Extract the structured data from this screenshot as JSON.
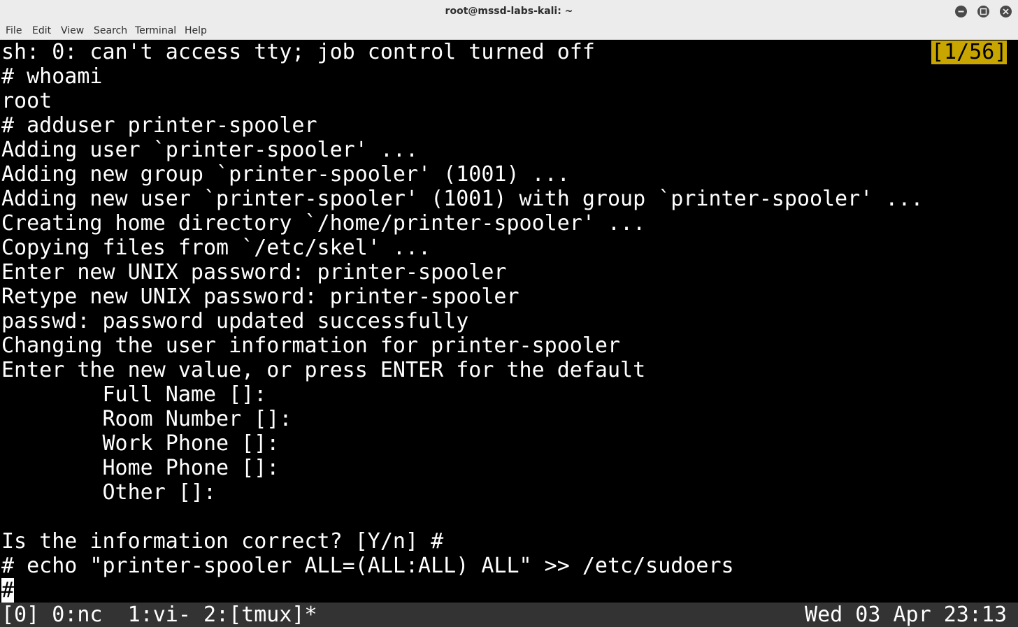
{
  "window": {
    "title": "root@mssd-labs-kali: ~",
    "controls": {
      "minimize_icon": "minimize-icon",
      "maximize_icon": "maximize-icon",
      "close_icon": "close-icon"
    }
  },
  "menu": {
    "items": [
      "File",
      "Edit",
      "View",
      "Search",
      "Terminal",
      "Help"
    ]
  },
  "terminal": {
    "pane_indicator": "[1/56]",
    "lines": [
      "sh: 0: can't access tty; job control turned off",
      "# whoami",
      "root",
      "# adduser printer-spooler",
      "Adding user `printer-spooler' ...",
      "Adding new group `printer-spooler' (1001) ...",
      "Adding new user `printer-spooler' (1001) with group `printer-spooler' ...",
      "Creating home directory `/home/printer-spooler' ...",
      "Copying files from `/etc/skel' ...",
      "Enter new UNIX password: printer-spooler",
      "Retype new UNIX password: printer-spooler",
      "passwd: password updated successfully",
      "Changing the user information for printer-spooler",
      "Enter the new value, or press ENTER for the default",
      "        Full Name []:",
      "        Room Number []:",
      "        Work Phone []:",
      "        Home Phone []:",
      "        Other []:",
      "",
      "Is the information correct? [Y/n] #",
      "# echo \"printer-spooler ALL=(ALL:ALL) ALL\" >> /etc/sudoers"
    ],
    "prompt": "#"
  },
  "statusbar": {
    "left": "[0] 0:nc  1:vi- 2:[tmux]*",
    "right": "Wed 03 Apr 23:13"
  },
  "colors": {
    "titlebar_bg": "#ececec",
    "terminal_bg": "#000000",
    "terminal_fg": "#ffffff",
    "pane_indicator_bg": "#c9a500",
    "statusbar_bg": "#333333"
  }
}
